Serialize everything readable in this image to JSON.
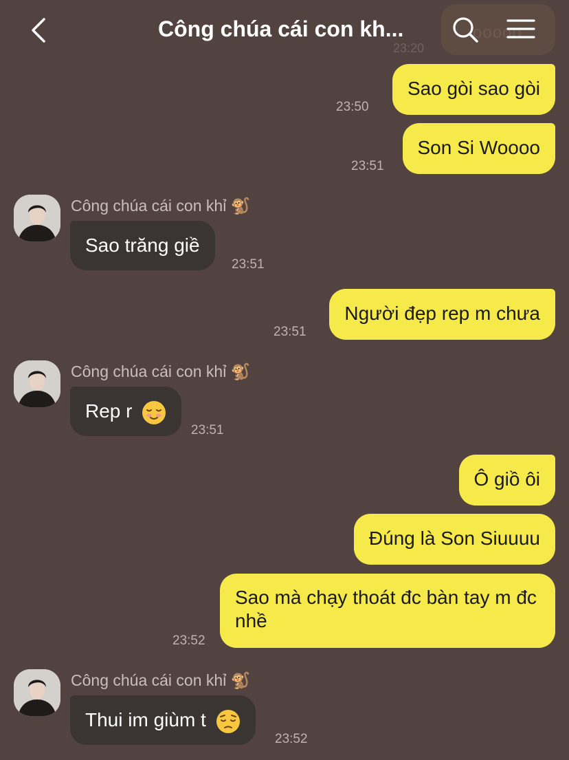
{
  "header": {
    "title": "Công chúa cái con kh...",
    "ghost_text": "ooooo",
    "ghost_time": "23:20"
  },
  "messages": [
    {
      "dir": "out",
      "text": "Sao gòi sao gòi",
      "time": "23:50"
    },
    {
      "dir": "out",
      "text": "Son Si Woooo",
      "time": "23:51"
    },
    {
      "dir": "in",
      "sender": "Công chúa cái con khỉ 🐒",
      "text": "Sao trăng giề",
      "time": "23:51"
    },
    {
      "dir": "out",
      "text": "Người đẹp rep m chưa",
      "time": "23:51"
    },
    {
      "dir": "in",
      "sender": "Công chúa cái con khỉ 🐒",
      "text": "Rep r",
      "emoji": "relieved-smile-emoji",
      "time": "23:51"
    },
    {
      "dir": "out",
      "text": "Ô giồ ôi"
    },
    {
      "dir": "out",
      "text": "Đúng là Son Siuuuu"
    },
    {
      "dir": "out",
      "text": "Sao mà chạy thoát đc bàn tay m đc nhề",
      "time": "23:52"
    },
    {
      "dir": "in",
      "sender": "Công chúa cái con khỉ 🐒",
      "text": "Thui im giùm t",
      "emoji": "pensive-face-emoji",
      "time": "23:52"
    }
  ],
  "colors": {
    "background": "#524340",
    "outgoing_bubble": "#f6e94a",
    "incoming_bubble": "#3a3433"
  },
  "icons": [
    "back-arrow-icon",
    "search-icon",
    "menu-icon"
  ]
}
